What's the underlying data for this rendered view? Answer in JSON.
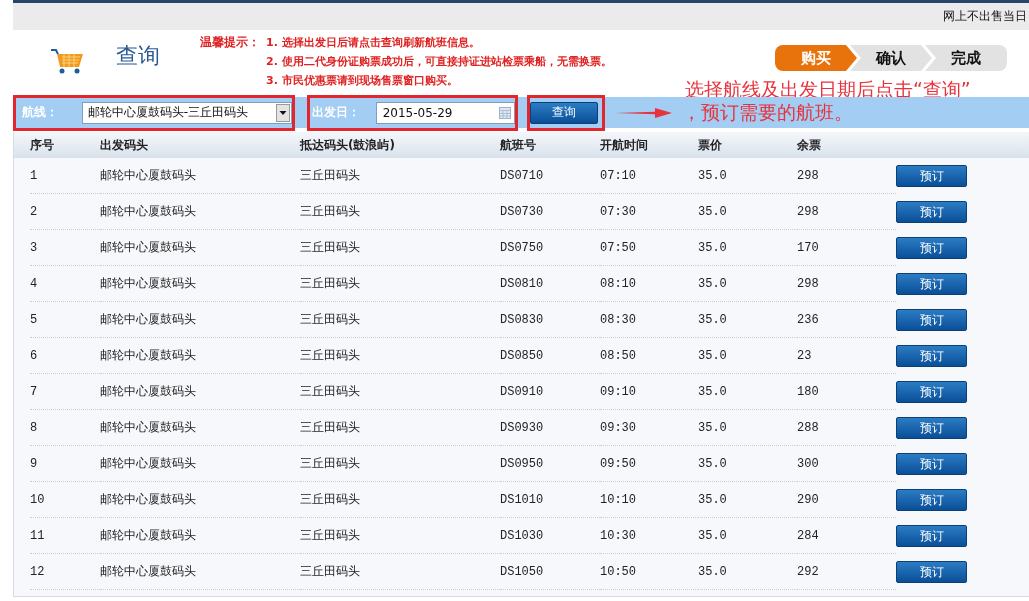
{
  "top_bar": {
    "notice": "网上不出售当日"
  },
  "header": {
    "title": "查询",
    "tips_label": "温馨提示：",
    "tips": [
      "1. 选择出发日后请点击查询刷新航班信息。",
      "2. 使用二代身份证购票成功后，可直接持证进站检票乘船，无需换票。",
      "3. 市民优惠票请到现场售票窗口购买。"
    ],
    "steps": [
      {
        "label": "购买",
        "selected": true
      },
      {
        "label": "确认",
        "selected": false
      },
      {
        "label": "完成",
        "selected": false
      }
    ]
  },
  "annotation": {
    "lines": [
      "选择航线及出发日期后点击“查询”",
      "，预订需要的航班。"
    ]
  },
  "filter": {
    "route_label": "航线：",
    "route_value": "邮轮中心厦鼓码头-三丘田码头",
    "date_label": "出发日：",
    "date_value": "2015-05-29",
    "query_button": "查询"
  },
  "table": {
    "columns": [
      "序号",
      "出发码头",
      "抵达码头(鼓浪屿)",
      "航班号",
      "开航时间",
      "票价",
      "余票"
    ],
    "rows": [
      {
        "cells": [
          "1",
          "邮轮中心厦鼓码头",
          "三丘田码头",
          "DS0710",
          "07:10",
          "35.0",
          "298"
        ],
        "action": "预订"
      },
      {
        "cells": [
          "2",
          "邮轮中心厦鼓码头",
          "三丘田码头",
          "DS0730",
          "07:30",
          "35.0",
          "298"
        ],
        "action": "预订"
      },
      {
        "cells": [
          "3",
          "邮轮中心厦鼓码头",
          "三丘田码头",
          "DS0750",
          "07:50",
          "35.0",
          "170"
        ],
        "action": "预订"
      },
      {
        "cells": [
          "4",
          "邮轮中心厦鼓码头",
          "三丘田码头",
          "DS0810",
          "08:10",
          "35.0",
          "298"
        ],
        "action": "预订"
      },
      {
        "cells": [
          "5",
          "邮轮中心厦鼓码头",
          "三丘田码头",
          "DS0830",
          "08:30",
          "35.0",
          "236"
        ],
        "action": "预订"
      },
      {
        "cells": [
          "6",
          "邮轮中心厦鼓码头",
          "三丘田码头",
          "DS0850",
          "08:50",
          "35.0",
          "23"
        ],
        "action": "预订"
      },
      {
        "cells": [
          "7",
          "邮轮中心厦鼓码头",
          "三丘田码头",
          "DS0910",
          "09:10",
          "35.0",
          "180"
        ],
        "action": "预订"
      },
      {
        "cells": [
          "8",
          "邮轮中心厦鼓码头",
          "三丘田码头",
          "DS0930",
          "09:30",
          "35.0",
          "288"
        ],
        "action": "预订"
      },
      {
        "cells": [
          "9",
          "邮轮中心厦鼓码头",
          "三丘田码头",
          "DS0950",
          "09:50",
          "35.0",
          "300"
        ],
        "action": "预订"
      },
      {
        "cells": [
          "10",
          "邮轮中心厦鼓码头",
          "三丘田码头",
          "DS1010",
          "10:10",
          "35.0",
          "290"
        ],
        "action": "预订"
      },
      {
        "cells": [
          "11",
          "邮轮中心厦鼓码头",
          "三丘田码头",
          "DS1030",
          "10:30",
          "35.0",
          "284"
        ],
        "action": "预订"
      },
      {
        "cells": [
          "12",
          "邮轮中心厦鼓码头",
          "三丘田码头",
          "DS1050",
          "10:50",
          "35.0",
          "292"
        ],
        "action": "预订"
      }
    ]
  }
}
